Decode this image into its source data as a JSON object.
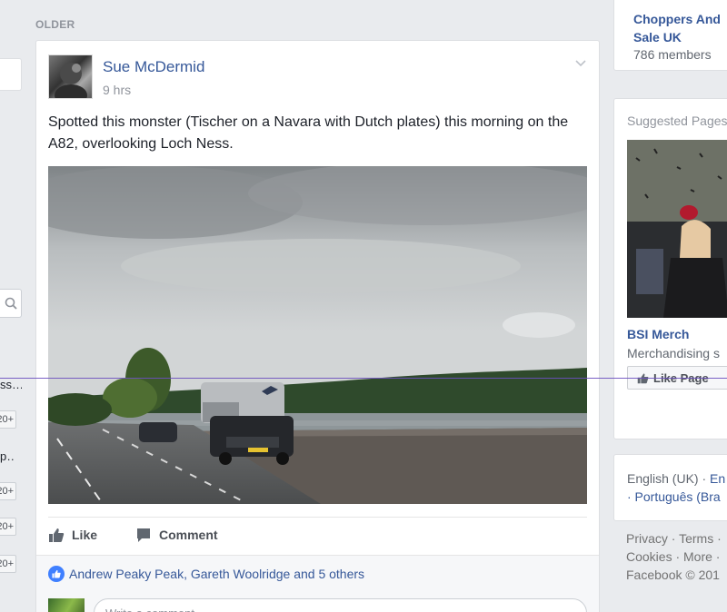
{
  "feed": {
    "section_label": "OLDER",
    "post": {
      "author": "Sue McDermid",
      "time": "9 hrs",
      "text": "Spotted this monster (Tischer on a Navara with Dutch plates) this morning on the A82, overlooking Loch Ness.",
      "actions": {
        "like": "Like",
        "comment": "Comment"
      },
      "reactions": "Andrew Peaky Peak, Gareth Woolridge and 5 others",
      "comment_placeholder": "Write a comment..."
    }
  },
  "left": {
    "items": [
      "ss…",
      "p…"
    ],
    "badges": [
      "20+",
      "20+",
      "20+",
      "20+"
    ]
  },
  "right": {
    "group": {
      "name": "Choppers And Sale UK",
      "members": "786 members"
    },
    "suggested": {
      "title": "Suggested Pages",
      "page_name": "BSI Merch",
      "category": "Merchandising s",
      "like_button": "Like Page"
    },
    "languages": {
      "current": "English (UK)",
      "alt1": "En",
      "alt2": "· Português (Bra"
    },
    "footer": [
      "Privacy · Terms ·",
      "Cookies · More ·",
      "Facebook © 201"
    ]
  },
  "colors": {
    "link": "#365899",
    "background": "#e9ebee",
    "like_blue": "#4080ff"
  }
}
